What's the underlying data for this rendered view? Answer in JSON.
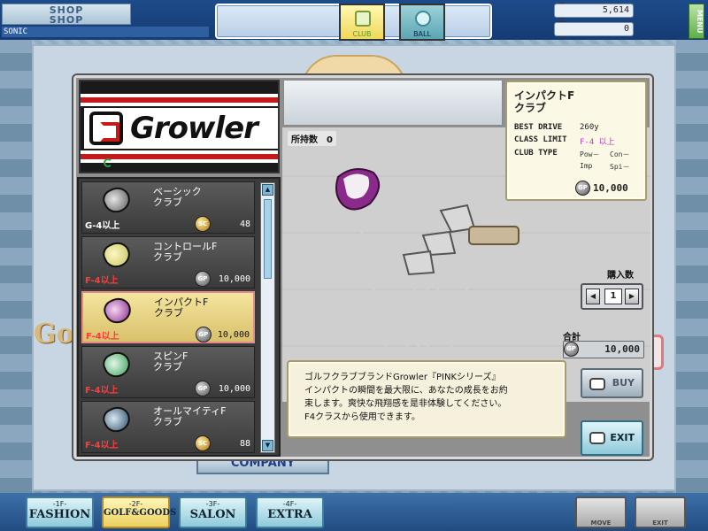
{
  "top": {
    "shop_sign": "SHOP\nSHOP",
    "user_name": "SONIC",
    "gp_icon": "GP",
    "gp_amount": "5,614",
    "sc_icon": "SC",
    "sc_amount": "0",
    "menu_label": "MENU"
  },
  "brand": {
    "name": "Growler"
  },
  "items": [
    {
      "name": "ベーシック\nクラブ",
      "limit": "G-4以上",
      "currency": "SC",
      "price": "48",
      "limit_ok": true
    },
    {
      "name": "コントロールF\nクラブ",
      "limit": "F-4以上",
      "currency": "GP",
      "price": "10,000",
      "limit_ok": false
    },
    {
      "name": "インパクトF\nクラブ",
      "limit": "F-4以上",
      "currency": "GP",
      "price": "10,000",
      "limit_ok": false
    },
    {
      "name": "スピンF\nクラブ",
      "limit": "F-4以上",
      "currency": "GP",
      "price": "10,000",
      "limit_ok": false
    },
    {
      "name": "オールマイティF\nクラブ",
      "limit": "F-4以上",
      "currency": "SC",
      "price": "88",
      "limit_ok": false
    }
  ],
  "scroll": {
    "up": "▲",
    "down": "▼"
  },
  "tabs": {
    "club": "CLUB",
    "ball": "BALL"
  },
  "owned": "所持数　0",
  "info": {
    "title": "インパクトF\nクラブ",
    "best_drive_label": "BEST DRIVE",
    "best_drive": "260y",
    "class_limit_label": "CLASS LIMIT",
    "class_limit": "F-4 以上",
    "club_type_label": "CLUB TYPE",
    "pow": "Pow－",
    "con": "Con－",
    "imp": "Imp",
    "spi": "Spi－",
    "currency": "GP",
    "price": "10,000"
  },
  "description": "ゴルフクラブブランドGrowler『PINKシリーズ』\nインパクトの瞬間を最大限に、あなたの成長をお約\n束します。爽快な飛翔感を是非体験してください。\nF4クラスから使用できます。",
  "purchase": {
    "qty_label": "購入数",
    "qty_dec": "◀",
    "qty": "1",
    "qty_inc": "▶",
    "total_label": "合計",
    "total_currency": "GP",
    "total": "10,000",
    "buy": "BUY",
    "exit": "EXIT"
  },
  "background": {
    "golf_logo": "Golf",
    "company": "COMPANY"
  },
  "floors": [
    {
      "num": "-1F-",
      "label": "FASHION"
    },
    {
      "num": "-2F-",
      "label": "GOLF&GOODS"
    },
    {
      "num": "-3F-",
      "label": "SALON"
    },
    {
      "num": "-4F-",
      "label": "EXTRA"
    }
  ],
  "bottom": {
    "move": "MOVE",
    "exit": "EXIT"
  },
  "colors": {
    "limit_red": "#ff3b3b",
    "selected_bg": "#f0dc8a",
    "accent_purple": "#c43cc4"
  }
}
